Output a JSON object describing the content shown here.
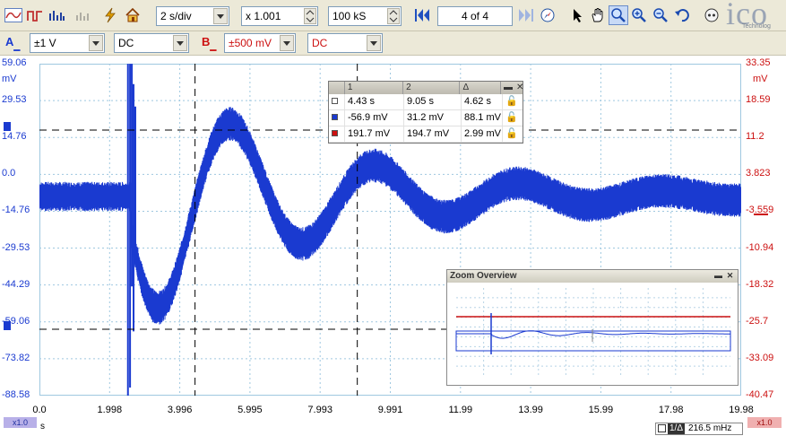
{
  "toolbar": {
    "timebase": "2 s/div",
    "zoom_factor": "x 1.001",
    "samples": "100 kS",
    "page_indicator": "4 of 4"
  },
  "channels": {
    "a": {
      "letter": "A",
      "range": "±1 V",
      "coupling": "DC",
      "color": "#1a3ad0"
    },
    "b": {
      "letter": "B",
      "range": "±500 mV",
      "coupling": "DC",
      "color": "#cc1010"
    }
  },
  "axes": {
    "left_ticks": [
      "59.06",
      "29.53",
      "14.76",
      "0.0",
      "-14.76",
      "-29.53",
      "-44.29",
      "-59.06",
      "-73.82",
      "-88.58"
    ],
    "left_unit": "mV",
    "right_ticks": [
      "33.35",
      "18.59",
      "11.2",
      "3.823",
      "-3.559",
      "-10.94",
      "-18.32",
      "-25.7",
      "-33.09",
      "-40.47"
    ],
    "right_unit": "mV",
    "x_ticks": [
      "0.0",
      "1.998",
      "3.996",
      "5.995",
      "7.993",
      "9.991",
      "11.99",
      "13.99",
      "15.99",
      "17.98",
      "19.98"
    ],
    "x_unit": "s",
    "left_scale": "x1.0",
    "right_scale": "x1.0"
  },
  "measurements": {
    "headers": [
      "1",
      "2",
      "Δ"
    ],
    "rows": [
      {
        "c1": "4.43 s",
        "c2": "9.05 s",
        "delta": "4.62 s",
        "swatch": "#ffffff"
      },
      {
        "c1": "-56.9 mV",
        "c2": "31.2 mV",
        "delta": "88.1 mV",
        "swatch": "#1a3ad0"
      },
      {
        "c1": "191.7 mV",
        "c2": "194.7 mV",
        "delta": "2.99 mV",
        "swatch": "#cc1010"
      }
    ]
  },
  "zoom_overview": {
    "title": "Zoom Overview"
  },
  "frequency": {
    "label": "1/Δ",
    "value": "216.5 mHz"
  },
  "logo_text": "ico",
  "logo_sub": "Technolog"
}
